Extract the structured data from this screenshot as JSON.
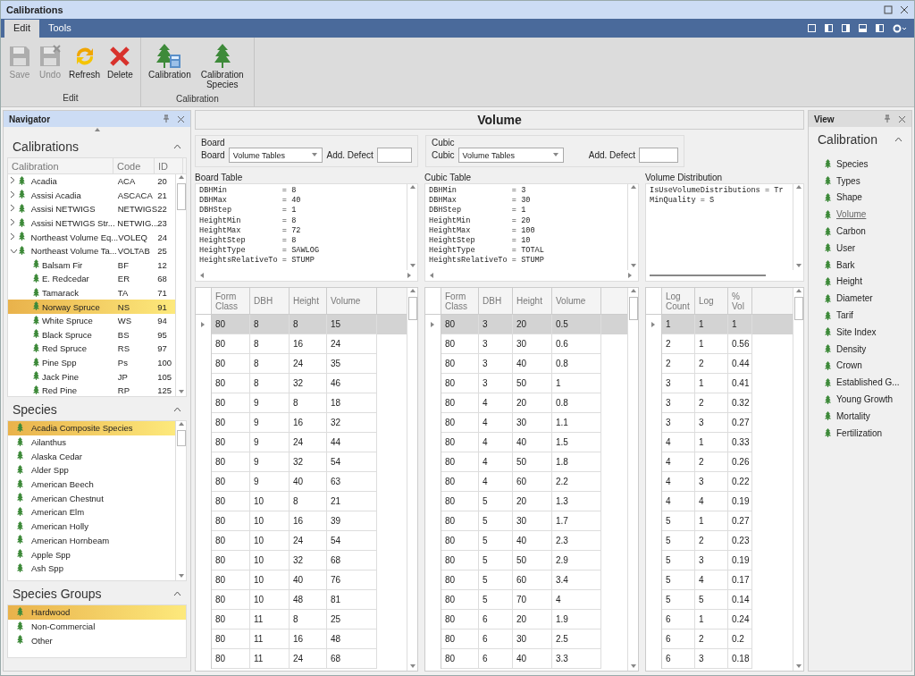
{
  "window": {
    "title": "Calibrations"
  },
  "ribbon": {
    "tabs": [
      {
        "label": "Edit",
        "selected": true
      },
      {
        "label": "Tools",
        "selected": false
      }
    ],
    "groups": [
      {
        "label": "Edit",
        "buttons": [
          {
            "label": "Save",
            "kind": "save",
            "disabled": true
          },
          {
            "label": "Undo",
            "kind": "undo",
            "disabled": true
          },
          {
            "label": "Refresh",
            "kind": "refresh",
            "disabled": false
          },
          {
            "label": "Delete",
            "kind": "delete",
            "disabled": false
          }
        ]
      },
      {
        "label": "Calibration",
        "buttons": [
          {
            "label": "Calibration",
            "kind": "calibration",
            "disabled": false
          },
          {
            "label": "Calibration Species",
            "kind": "species",
            "disabled": false
          }
        ]
      }
    ]
  },
  "navigator": {
    "title": "Navigator",
    "calibrations": {
      "title": "Calibrations",
      "columns": [
        "Calibration",
        "Code",
        "ID"
      ],
      "rows": [
        {
          "name": "Acadia",
          "code": "ACA",
          "id": "20",
          "expanded": false,
          "selected": false
        },
        {
          "name": "Assisi Acadia",
          "code": "ASCACA",
          "id": "21",
          "expanded": false,
          "selected": false
        },
        {
          "name": "Assisi NETWIGS",
          "code": "NETWIGS",
          "id": "22",
          "expanded": false,
          "selected": false
        },
        {
          "name": "Assisi NETWIGS Str...",
          "code": "NETWIG...",
          "id": "23",
          "expanded": false,
          "selected": false
        },
        {
          "name": "Northeast Volume Eq...",
          "code": "VOLEQ",
          "id": "24",
          "expanded": false,
          "selected": false
        },
        {
          "name": "Northeast Volume Ta...",
          "code": "VOLTAB",
          "id": "25",
          "expanded": true,
          "selected": false,
          "children": [
            {
              "name": "Balsam Fir",
              "code": "BF",
              "id": "12",
              "selected": false
            },
            {
              "name": "E. Redcedar",
              "code": "ER",
              "id": "68",
              "selected": false
            },
            {
              "name": "Tamarack",
              "code": "TA",
              "id": "71",
              "selected": false
            },
            {
              "name": "Norway Spruce",
              "code": "NS",
              "id": "91",
              "selected": true
            },
            {
              "name": "White Spruce",
              "code": "WS",
              "id": "94",
              "selected": false
            },
            {
              "name": "Black Spruce",
              "code": "BS",
              "id": "95",
              "selected": false
            },
            {
              "name": "Red Spruce",
              "code": "RS",
              "id": "97",
              "selected": false
            },
            {
              "name": "Pine Spp",
              "code": "Ps",
              "id": "100",
              "selected": false
            },
            {
              "name": "Jack Pine",
              "code": "JP",
              "id": "105",
              "selected": false
            },
            {
              "name": "Red Pine",
              "code": "RP",
              "id": "125",
              "selected": false
            }
          ]
        }
      ]
    },
    "species": {
      "title": "Species",
      "items": [
        {
          "label": "Acadia Composite Species",
          "selected": true
        },
        {
          "label": "Ailanthus",
          "selected": false
        },
        {
          "label": "Alaska Cedar",
          "selected": false
        },
        {
          "label": "Alder Spp",
          "selected": false
        },
        {
          "label": "American Beech",
          "selected": false
        },
        {
          "label": "American Chestnut",
          "selected": false
        },
        {
          "label": "American Elm",
          "selected": false
        },
        {
          "label": "American Holly",
          "selected": false
        },
        {
          "label": "American Hornbeam",
          "selected": false
        },
        {
          "label": "Apple Spp",
          "selected": false
        },
        {
          "label": "Ash Spp",
          "selected": false
        }
      ]
    },
    "species_groups": {
      "title": "Species Groups",
      "items": [
        {
          "label": "Hardwood",
          "selected": true
        },
        {
          "label": "Non-Commercial",
          "selected": false
        },
        {
          "label": "Other",
          "selected": false
        }
      ]
    }
  },
  "editor": {
    "title": "Volume",
    "selectors": [
      {
        "group": "Board",
        "label": "Board",
        "value": "Volume Tables",
        "defect_label": "Add. Defect"
      },
      {
        "group": "Cubic",
        "label": "Cubic",
        "value": "Volume Tables",
        "defect_label": "Add. Defect"
      }
    ],
    "panels": [
      {
        "title": "Board Table",
        "lines": [
          "DBHMin            = 8",
          "DBHMax            = 40",
          "DBHStep           = 1",
          "HeightMin         = 8",
          "HeightMax         = 72",
          "HeightStep        = 8",
          "HeightType        = SAWLOG",
          "HeightsRelativeTo = STUMP"
        ],
        "columns": [
          "Form Class",
          "DBH",
          "Height",
          "Volume"
        ],
        "rows": [
          {
            "cells": [
              "80",
              "8",
              "8",
              "15"
            ],
            "selected": true
          },
          {
            "cells": [
              "80",
              "8",
              "16",
              "24"
            ],
            "selected": false
          },
          {
            "cells": [
              "80",
              "8",
              "24",
              "35"
            ],
            "selected": false
          },
          {
            "cells": [
              "80",
              "8",
              "32",
              "46"
            ],
            "selected": false
          },
          {
            "cells": [
              "80",
              "9",
              "8",
              "18"
            ],
            "selected": false
          },
          {
            "cells": [
              "80",
              "9",
              "16",
              "32"
            ],
            "selected": false
          },
          {
            "cells": [
              "80",
              "9",
              "24",
              "44"
            ],
            "selected": false
          },
          {
            "cells": [
              "80",
              "9",
              "32",
              "54"
            ],
            "selected": false
          },
          {
            "cells": [
              "80",
              "9",
              "40",
              "63"
            ],
            "selected": false
          },
          {
            "cells": [
              "80",
              "10",
              "8",
              "21"
            ],
            "selected": false
          },
          {
            "cells": [
              "80",
              "10",
              "16",
              "39"
            ],
            "selected": false
          },
          {
            "cells": [
              "80",
              "10",
              "24",
              "54"
            ],
            "selected": false
          },
          {
            "cells": [
              "80",
              "10",
              "32",
              "68"
            ],
            "selected": false
          },
          {
            "cells": [
              "80",
              "10",
              "40",
              "76"
            ],
            "selected": false
          },
          {
            "cells": [
              "80",
              "10",
              "48",
              "81"
            ],
            "selected": false
          },
          {
            "cells": [
              "80",
              "11",
              "8",
              "25"
            ],
            "selected": false
          },
          {
            "cells": [
              "80",
              "11",
              "16",
              "48"
            ],
            "selected": false
          },
          {
            "cells": [
              "80",
              "11",
              "24",
              "68"
            ],
            "selected": false
          }
        ]
      },
      {
        "title": "Cubic Table",
        "lines": [
          "DBHMin            = 3",
          "DBHMax            = 30",
          "DBHStep           = 1",
          "HeightMin         = 20",
          "HeightMax         = 100",
          "HeightStep        = 10",
          "HeightType        = TOTAL",
          "HeightsRelativeTo = STUMP"
        ],
        "columns": [
          "Form Class",
          "DBH",
          "Height",
          "Volume"
        ],
        "rows": [
          {
            "cells": [
              "80",
              "3",
              "20",
              "0.5"
            ],
            "selected": true
          },
          {
            "cells": [
              "80",
              "3",
              "30",
              "0.6"
            ],
            "selected": false
          },
          {
            "cells": [
              "80",
              "3",
              "40",
              "0.8"
            ],
            "selected": false
          },
          {
            "cells": [
              "80",
              "3",
              "50",
              "1"
            ],
            "selected": false
          },
          {
            "cells": [
              "80",
              "4",
              "20",
              "0.8"
            ],
            "selected": false
          },
          {
            "cells": [
              "80",
              "4",
              "30",
              "1.1"
            ],
            "selected": false
          },
          {
            "cells": [
              "80",
              "4",
              "40",
              "1.5"
            ],
            "selected": false
          },
          {
            "cells": [
              "80",
              "4",
              "50",
              "1.8"
            ],
            "selected": false
          },
          {
            "cells": [
              "80",
              "4",
              "60",
              "2.2"
            ],
            "selected": false
          },
          {
            "cells": [
              "80",
              "5",
              "20",
              "1.3"
            ],
            "selected": false
          },
          {
            "cells": [
              "80",
              "5",
              "30",
              "1.7"
            ],
            "selected": false
          },
          {
            "cells": [
              "80",
              "5",
              "40",
              "2.3"
            ],
            "selected": false
          },
          {
            "cells": [
              "80",
              "5",
              "50",
              "2.9"
            ],
            "selected": false
          },
          {
            "cells": [
              "80",
              "5",
              "60",
              "3.4"
            ],
            "selected": false
          },
          {
            "cells": [
              "80",
              "5",
              "70",
              "4"
            ],
            "selected": false
          },
          {
            "cells": [
              "80",
              "6",
              "20",
              "1.9"
            ],
            "selected": false
          },
          {
            "cells": [
              "80",
              "6",
              "30",
              "2.5"
            ],
            "selected": false
          },
          {
            "cells": [
              "80",
              "6",
              "40",
              "3.3"
            ],
            "selected": false
          }
        ]
      },
      {
        "title": "Volume Distribution",
        "lines": [
          "IsUseVolumeDistributions = Tr",
          "MinQuality = S"
        ],
        "columns": [
          "Log Count",
          "Log",
          "% Vol"
        ],
        "rows": [
          {
            "cells": [
              "1",
              "1",
              "1"
            ],
            "selected": true
          },
          {
            "cells": [
              "2",
              "1",
              "0.56"
            ],
            "selected": false
          },
          {
            "cells": [
              "2",
              "2",
              "0.44"
            ],
            "selected": false
          },
          {
            "cells": [
              "3",
              "1",
              "0.41"
            ],
            "selected": false
          },
          {
            "cells": [
              "3",
              "2",
              "0.32"
            ],
            "selected": false
          },
          {
            "cells": [
              "3",
              "3",
              "0.27"
            ],
            "selected": false
          },
          {
            "cells": [
              "4",
              "1",
              "0.33"
            ],
            "selected": false
          },
          {
            "cells": [
              "4",
              "2",
              "0.26"
            ],
            "selected": false
          },
          {
            "cells": [
              "4",
              "3",
              "0.22"
            ],
            "selected": false
          },
          {
            "cells": [
              "4",
              "4",
              "0.19"
            ],
            "selected": false
          },
          {
            "cells": [
              "5",
              "1",
              "0.27"
            ],
            "selected": false
          },
          {
            "cells": [
              "5",
              "2",
              "0.23"
            ],
            "selected": false
          },
          {
            "cells": [
              "5",
              "3",
              "0.19"
            ],
            "selected": false
          },
          {
            "cells": [
              "5",
              "4",
              "0.17"
            ],
            "selected": false
          },
          {
            "cells": [
              "5",
              "5",
              "0.14"
            ],
            "selected": false
          },
          {
            "cells": [
              "6",
              "1",
              "0.24"
            ],
            "selected": false
          },
          {
            "cells": [
              "6",
              "2",
              "0.2"
            ],
            "selected": false
          },
          {
            "cells": [
              "6",
              "3",
              "0.18"
            ],
            "selected": false
          }
        ]
      }
    ]
  },
  "view": {
    "title": "View",
    "section": "Calibration",
    "items": [
      {
        "label": "Species",
        "selected": false
      },
      {
        "label": "Types",
        "selected": false
      },
      {
        "label": "Shape",
        "selected": false
      },
      {
        "label": "Volume",
        "selected": true
      },
      {
        "label": "Carbon",
        "selected": false
      },
      {
        "label": "User",
        "selected": false
      },
      {
        "label": "Bark",
        "selected": false
      },
      {
        "label": "Height",
        "selected": false
      },
      {
        "label": "Diameter",
        "selected": false
      },
      {
        "label": "Tarif",
        "selected": false
      },
      {
        "label": "Site Index",
        "selected": false
      },
      {
        "label": "Density",
        "selected": false
      },
      {
        "label": "Crown",
        "selected": false
      },
      {
        "label": "Established G...",
        "selected": false
      },
      {
        "label": "Young Growth",
        "selected": false
      },
      {
        "label": "Mortality",
        "selected": false
      },
      {
        "label": "Fertilization",
        "selected": false
      }
    ]
  }
}
